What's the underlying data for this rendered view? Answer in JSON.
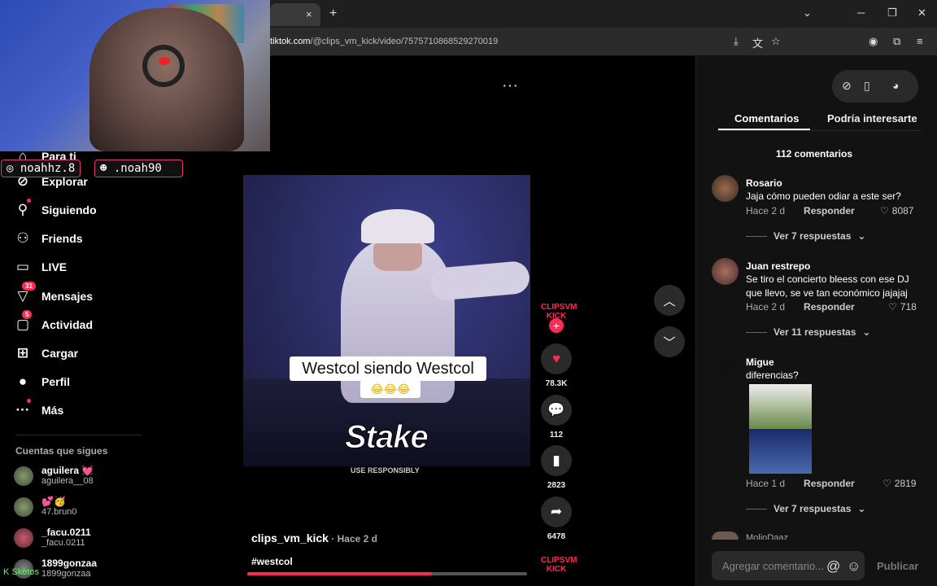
{
  "browser": {
    "tab_close": "×",
    "new_tab": "+",
    "url_host": "tiktok.com",
    "url_path": "/@clips_vm_kick/video/7575710868529270019"
  },
  "overlay": {
    "instagram": "noahhz.8",
    "kick": ".noah90",
    "kick_bottom": "Sketos"
  },
  "sidebar": {
    "items": [
      {
        "label": "Para ti"
      },
      {
        "label": "Explorar"
      },
      {
        "label": "Siguiendo"
      },
      {
        "label": "Friends"
      },
      {
        "label": "LIVE"
      },
      {
        "label": "Mensajes",
        "badge": "31"
      },
      {
        "label": "Actividad",
        "badge": "5"
      },
      {
        "label": "Cargar"
      },
      {
        "label": "Perfil"
      },
      {
        "label": "Más"
      }
    ],
    "following_title": "Cuentas que sigues",
    "following": [
      {
        "name": "aguilera 💓",
        "handle": "aguilera__08"
      },
      {
        "name": "💕🥳",
        "handle": "47.brun0"
      },
      {
        "name": "_facu.0211",
        "handle": "_facu.0211"
      },
      {
        "name": "1899gonzaa",
        "handle": "1899gonzaa"
      }
    ]
  },
  "video": {
    "caption": "Westcol siendo Westcol",
    "caption_emoji": "😂😂😂",
    "sponsor": "Stake",
    "sponsor_sub": "USE RESPONSIBLY",
    "creator": "clips_vm_kick",
    "posted": " · Hace 2 d",
    "hashtag": "#westcol",
    "progress": 0.66,
    "creator_badge": "CLIPSVM KICK",
    "more": "···"
  },
  "actions": {
    "likes": "78.3K",
    "comments": "112",
    "saves": "2823",
    "shares": "6478"
  },
  "panel": {
    "tab_comments": "Comentarios",
    "tab_interest": "Podría interesarte",
    "comment_count": "112 comentarios",
    "reply_label": "Responder",
    "comments": [
      {
        "user": "Rosario",
        "text": "Jaja cómo pueden odiar a este ser?",
        "time": "Hace 2 d",
        "likes": "8087",
        "replies": "Ver 7 respuestas"
      },
      {
        "user": "Juan restrepo",
        "text": "Se tiro el concierto bleess con ese DJ que llevo, se ve tan económico jajajaj",
        "time": "Hace 2 d",
        "likes": "718",
        "replies": "Ver 11 respuestas"
      },
      {
        "user": "Migue",
        "text": "diferencias?",
        "time": "Hace 1 d",
        "likes": "2819",
        "replies": "Ver 7 respuestas"
      }
    ],
    "next_user": "MolioDaaz",
    "input_placeholder": "Agregar comentario...",
    "publish": "Publicar"
  }
}
